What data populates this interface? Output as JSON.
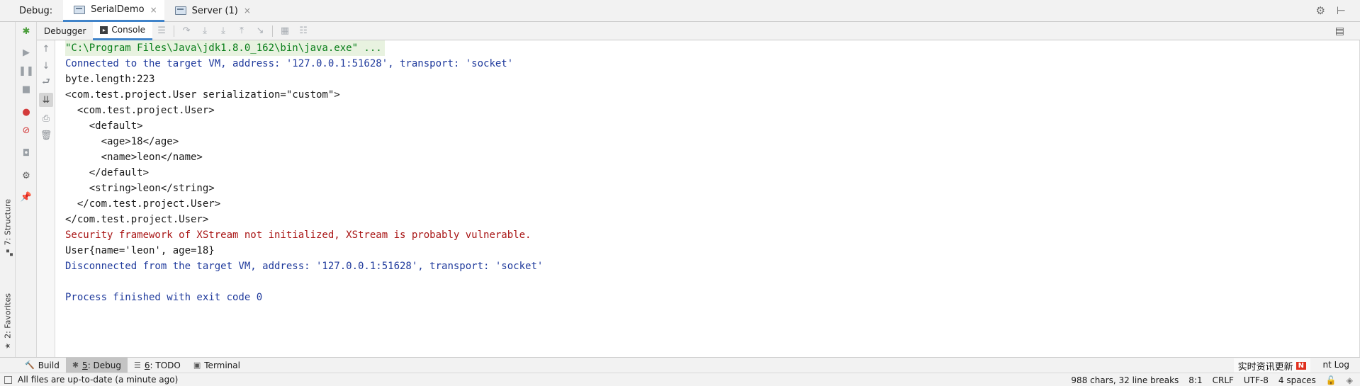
{
  "debug_bar": {
    "label": "Debug:",
    "tabs": [
      {
        "label": "SerialDemo",
        "close": "×"
      },
      {
        "label": "Server (1)",
        "close": "×"
      }
    ],
    "settings_icon": "gear-icon",
    "minimize_icon": "minimize-icon"
  },
  "subtabs": {
    "debugger_label": "Debugger",
    "console_label": "Console"
  },
  "left_strip": {
    "structure_label": "7: Structure",
    "favorites_label": "2: Favorites"
  },
  "console": {
    "lines": [
      {
        "kind": "cmd",
        "text": "\"C:\\Program Files\\Java\\jdk1.8.0_162\\bin\\java.exe\" ..."
      },
      {
        "kind": "sys",
        "text": "Connected to the target VM, address: '127.0.0.1:51628', transport: 'socket'"
      },
      {
        "kind": "out",
        "text": "byte.length:223"
      },
      {
        "kind": "out",
        "text": "<com.test.project.User serialization=\"custom\">"
      },
      {
        "kind": "out",
        "text": "  <com.test.project.User>"
      },
      {
        "kind": "out",
        "text": "    <default>"
      },
      {
        "kind": "out",
        "text": "      <age>18</age>"
      },
      {
        "kind": "out",
        "text": "      <name>leon</name>"
      },
      {
        "kind": "out",
        "text": "    </default>"
      },
      {
        "kind": "out",
        "text": "    <string>leon</string>"
      },
      {
        "kind": "out",
        "text": "  </com.test.project.User>"
      },
      {
        "kind": "out",
        "text": "</com.test.project.User>"
      },
      {
        "kind": "err",
        "text": "Security framework of XStream not initialized, XStream is probably vulnerable."
      },
      {
        "kind": "out",
        "text": "User{name='leon', age=18}"
      },
      {
        "kind": "sys",
        "text": "Disconnected from the target VM, address: '127.0.0.1:51628', transport: 'socket'"
      },
      {
        "kind": "out",
        "text": ""
      },
      {
        "kind": "sys",
        "text": "Process finished with exit code 0"
      }
    ]
  },
  "bottom_bar": {
    "build_label": "Build",
    "debug_num": "5",
    "debug_label": ": Debug",
    "todo_num": "6",
    "todo_label": ": TODO",
    "terminal_label": "Terminal",
    "ad_text": "实时资讯更新",
    "ad_badge": "N",
    "event_log_label": "nt Log"
  },
  "status_bar": {
    "message": "All files are up-to-date (a minute ago)",
    "chars": "988 chars, 32 line breaks",
    "position": "8:1",
    "line_sep": "CRLF",
    "encoding": "UTF-8",
    "indent": "4 spaces"
  }
}
